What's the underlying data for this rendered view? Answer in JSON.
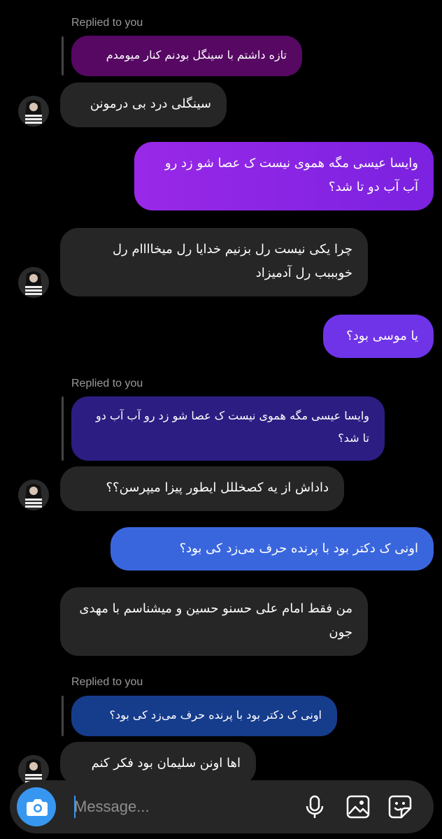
{
  "thread": {
    "messages": [
      {
        "id": "m1",
        "reply_label": "Replied to you",
        "quote": "تازه داشتم با سینگل بودنم کنار میومدم",
        "text": "سینگلی درد بی درمونن"
      },
      {
        "id": "m2",
        "text": "وایسا عیسی مگه هموی نیست ک عصا شو زد رو آب آب دو تا شد؟"
      },
      {
        "id": "m3",
        "text": "چرا یکی نیست رل بزنیم خدایا رل میخاااام رل خوبببب رل آدمیزاد"
      },
      {
        "id": "m4",
        "text": "یا موسی بود؟"
      },
      {
        "id": "m5",
        "reply_label": "Replied to you",
        "quote": "وایسا عیسی مگه هموی نیست ک عصا شو زد رو آب آب دو تا شد؟",
        "text": "داداش از یه کصخللل ایطور پیزا میپرسن؟؟"
      },
      {
        "id": "m6",
        "text": "اونی ک دکتر بود با پرنده حرف می‌زد کی بود؟"
      },
      {
        "id": "m7",
        "text": "من فقط امام علی حسنو حسین و میشناسم با مهدی جون"
      },
      {
        "id": "m8",
        "reply_label": "Replied to you",
        "quote": "اونی ک دکتر بود با پرنده حرف می‌زد کی بود؟",
        "text": "اها اونن سلیمان بود فکر کنم"
      }
    ]
  },
  "composer": {
    "placeholder": "Message...",
    "icons": [
      "camera-icon",
      "microphone-icon",
      "gallery-icon",
      "sticker-icon"
    ]
  },
  "colors": {
    "background": "#000000",
    "incoming_bubble": "#262626",
    "accent_blue": "#3797f0"
  }
}
